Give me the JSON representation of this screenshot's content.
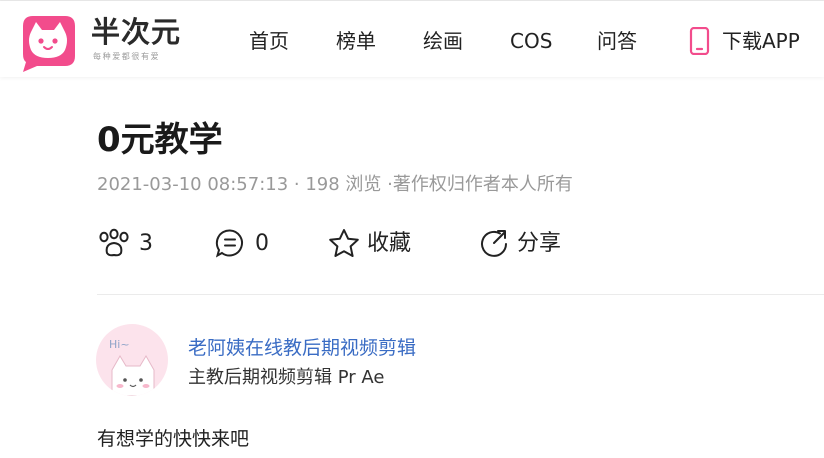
{
  "brand": {
    "name": "半次元",
    "slogan": "每种爱都很有爱",
    "color": "#f24c8c"
  },
  "nav": {
    "items": [
      {
        "label": "首页"
      },
      {
        "label": "榜单"
      },
      {
        "label": "绘画"
      },
      {
        "label": "COS"
      },
      {
        "label": "问答"
      }
    ],
    "download": {
      "label": "下载APP",
      "icon": "phone-icon"
    }
  },
  "post": {
    "title": "0元教学",
    "meta": "2021-03-10 08:57:13 · 198 浏览 ·著作权归作者本人所有",
    "actions": {
      "like": {
        "icon": "paw-icon",
        "count": "3"
      },
      "comment": {
        "icon": "comment-icon",
        "count": "0"
      },
      "favorite": {
        "icon": "star-icon",
        "label": "收藏"
      },
      "share": {
        "icon": "share-icon",
        "label": "分享"
      }
    },
    "author": {
      "name": "老阿姨在线教后期视频剪辑",
      "description": "主教后期视频剪辑 Pr Ae",
      "avatar_text": "Hi~"
    },
    "body": "有想学的快快来吧"
  }
}
